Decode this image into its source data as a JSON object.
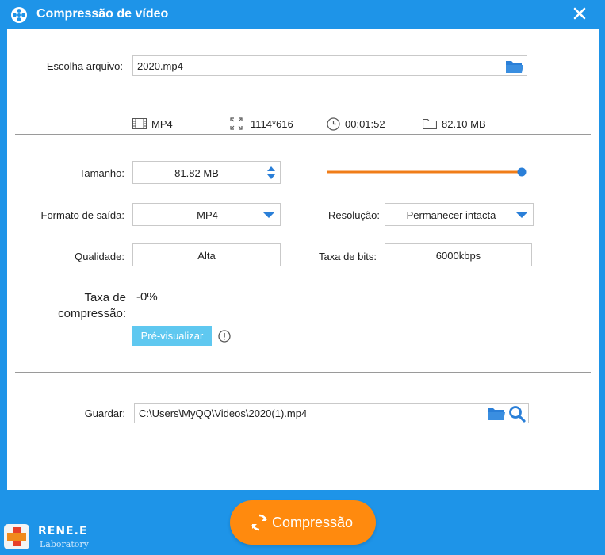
{
  "window": {
    "title": "Compressão de vídeo"
  },
  "file": {
    "label": "Escolha arquivo:",
    "value": "2020.mp4",
    "format": "MP4",
    "resolution": "1114*616",
    "duration": "00:01:52",
    "size": "82.10 MB"
  },
  "settings": {
    "size_label": "Tamanho:",
    "size_value": "81.82 MB",
    "size_slider_fraction": 1.0,
    "output_format_label": "Formato de saída:",
    "output_format_value": "MP4",
    "resolution_label": "Resolução:",
    "resolution_value": "Permanecer intacta",
    "quality_label": "Qualidade:",
    "quality_value": "Alta",
    "bitrate_label": "Taxa de bits:",
    "bitrate_value": "6000kbps",
    "compression_label_line1": "Taxa de",
    "compression_label_line2": "compressão:",
    "compression_value": "-0%",
    "preview_button": "Pré-visualizar"
  },
  "save": {
    "label": "Guardar:",
    "path": "C:\\Users\\MyQQ\\Videos\\2020(1).mp4"
  },
  "actions": {
    "compress_button": "Compressão"
  },
  "brand": {
    "name": "RENE.E",
    "subtitle": "Laboratory"
  },
  "colors": {
    "titlebar": "#1e94e8",
    "accent": "#ff8a0e",
    "link_blue": "#2a7fd8",
    "preview": "#5fc8f0"
  }
}
